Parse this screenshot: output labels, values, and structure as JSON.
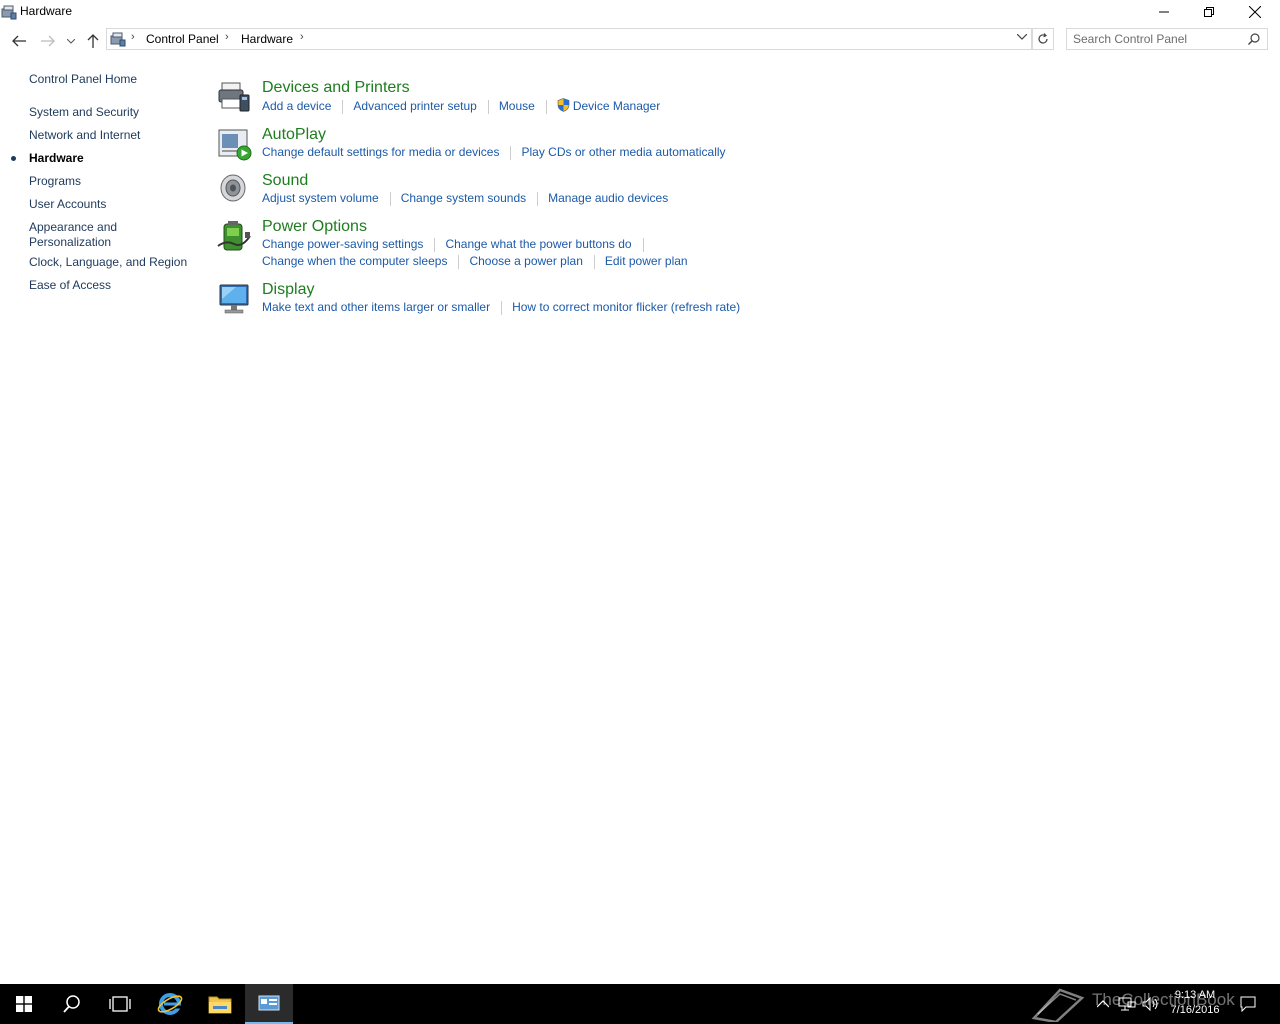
{
  "window": {
    "title": "Hardware",
    "min_label": "Minimize",
    "restore_label": "Restore",
    "close_label": "Close"
  },
  "address": {
    "crumbs": [
      "Control Panel",
      "Hardware"
    ],
    "search_placeholder": "Search Control Panel"
  },
  "leftnav": {
    "home": "Control Panel Home",
    "items": [
      {
        "label": "System and Security"
      },
      {
        "label": "Network and Internet"
      },
      {
        "label": "Hardware",
        "active": true
      },
      {
        "label": "Programs"
      },
      {
        "label": "User Accounts"
      },
      {
        "label": "Appearance and Personalization",
        "line1": "Appearance and",
        "line2": "Personalization"
      },
      {
        "label": "Clock, Language, and Region"
      },
      {
        "label": "Ease of Access"
      }
    ]
  },
  "categories": [
    {
      "title": "Devices and Printers",
      "icon": "printer-icon",
      "links": [
        "Add a device",
        "Advanced printer setup",
        "Mouse",
        "Device Manager"
      ]
    },
    {
      "title": "AutoPlay",
      "icon": "autoplay-icon",
      "links": [
        "Change default settings for media or devices",
        "Play CDs or other media automatically"
      ]
    },
    {
      "title": "Sound",
      "icon": "speaker-icon",
      "links": [
        "Adjust system volume",
        "Change system sounds",
        "Manage audio devices"
      ]
    },
    {
      "title": "Power Options",
      "icon": "battery-icon",
      "links": [
        "Change power-saving settings",
        "Change what the power buttons do",
        "Change when the computer sleeps",
        "Choose a power plan",
        "Edit power plan"
      ]
    },
    {
      "title": "Display",
      "icon": "monitor-icon",
      "links": [
        "Make text and other items larger or smaller",
        "How to correct monitor flicker (refresh rate)"
      ]
    }
  ],
  "taskbar": {
    "time": "9:13 AM",
    "date": "7/16/2016",
    "watermark": "TheCollectionBook"
  },
  "colors": {
    "category_title": "#1e7d1e",
    "link": "#1c5aa8",
    "nav_text": "#1e395b",
    "taskbar": "#000000"
  }
}
